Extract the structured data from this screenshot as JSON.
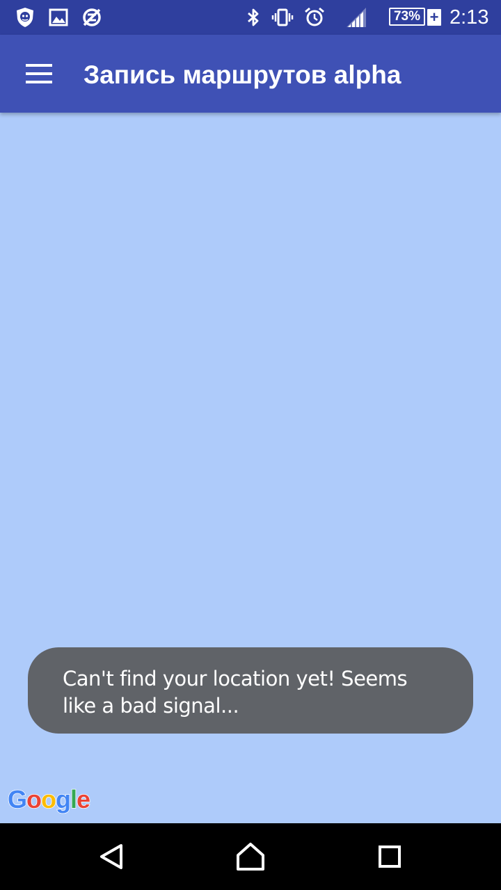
{
  "status_bar": {
    "left_icons": [
      "dr-web-shield-icon",
      "image-icon",
      "no-sync-icon"
    ],
    "right_icons": [
      "bluetooth-icon",
      "vibrate-icon",
      "alarm-icon",
      "signal-icon"
    ],
    "battery_level": "73%",
    "battery_charging_symbol": "+",
    "time": "2:13"
  },
  "app_bar": {
    "menu_icon": "hamburger-menu-icon",
    "title": "Запись маршрутов alpha",
    "color": "#3f51b5"
  },
  "map": {
    "background_color": "#aecbfa",
    "toast_message": "Can't find your location yet! Seems like a bad signal...",
    "attribution": "Google"
  },
  "nav_bar": {
    "buttons": [
      "back-icon",
      "home-icon",
      "recents-icon"
    ]
  }
}
